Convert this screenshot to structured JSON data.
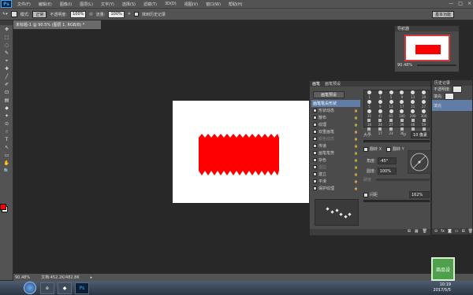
{
  "app": {
    "logo": "Ps"
  },
  "menu": [
    "文件(F)",
    "编辑(E)",
    "图像(I)",
    "图层(L)",
    "文字(Y)",
    "选择(S)",
    "滤镜(T)",
    "3D(D)",
    "视图(V)",
    "窗口(W)",
    "帮助(H)"
  ],
  "window_controls": {
    "minimize": "—",
    "maximize": "□",
    "close": "×"
  },
  "options_bar": {
    "mode_label": "模式:",
    "mode_value": "正常",
    "opacity_label": "不透明度:",
    "opacity_value": "100%",
    "flow_label": "流量:",
    "flow_value": "100%",
    "history_label": "抹到历史记录",
    "workspace_value": "基本功能"
  },
  "tools": [
    "✥",
    "⬚",
    "◌",
    "✎",
    "⌖",
    "✚",
    "╱",
    "✐",
    "⊡",
    "▤",
    "◆",
    "✦",
    "⊙",
    "☝",
    "T",
    "↖",
    "▭",
    "✋",
    "🔍"
  ],
  "document": {
    "tab_title": "未标题-1 @ 90.5% (图层 1, RGB/8) *",
    "zoom": "90.48%",
    "doc_size": "文档:452.2K/482.8K"
  },
  "navigator": {
    "title": "导航器",
    "zoom": "90.48%"
  },
  "history_panel": {
    "title": "历史记录",
    "opacity_label": "不透明度:",
    "fill_label": "填充:",
    "layer_name": "填充"
  },
  "brush_panel": {
    "tabs": [
      "画笔",
      "画笔预设"
    ],
    "preset_button": "画笔预设",
    "options": [
      {
        "label": "画笔笔尖形状",
        "active": true,
        "lock": false,
        "dim": false
      },
      {
        "label": "形状动态",
        "active": false,
        "lock": true,
        "dim": false
      },
      {
        "label": "散布",
        "active": false,
        "lock": true,
        "dim": false
      },
      {
        "label": "纹理",
        "active": false,
        "lock": true,
        "dim": false
      },
      {
        "label": "双重画笔",
        "active": false,
        "lock": true,
        "dim": false
      },
      {
        "label": "颜色动态",
        "active": false,
        "lock": true,
        "dim": true
      },
      {
        "label": "传递",
        "active": false,
        "lock": true,
        "dim": false
      },
      {
        "label": "画笔笔势",
        "active": false,
        "lock": true,
        "dim": false
      },
      {
        "label": "杂色",
        "active": false,
        "lock": true,
        "dim": false
      },
      {
        "label": "湿边",
        "active": false,
        "lock": true,
        "dim": true
      },
      {
        "label": "建立",
        "active": false,
        "lock": true,
        "dim": false
      },
      {
        "label": "平滑",
        "active": false,
        "lock": true,
        "dim": false
      },
      {
        "label": "保护纹理",
        "active": false,
        "lock": true,
        "dim": false
      }
    ],
    "tip_sizes": [
      "1",
      "3",
      "5",
      "9",
      "13",
      "19",
      "5",
      "9",
      "13",
      "17",
      "21",
      "27",
      "35",
      "45",
      "65",
      "100",
      "200",
      "300",
      "14",
      "24",
      "27",
      "39",
      "46",
      "59",
      "11",
      "17",
      "23",
      "36",
      "44",
      "60"
    ],
    "size_label": "大小",
    "size_value": "10 像素",
    "flip_x": "翻转 X",
    "flip_y": "翻转 Y",
    "angle_label": "角度:",
    "angle_value": "-45°",
    "roundness_label": "圆度:",
    "roundness_value": "100%",
    "hardness_label": "硬度",
    "spacing_label": "间距",
    "spacing_value": "162%",
    "footer_icons": [
      "⊞",
      "▦",
      "🗑"
    ]
  },
  "taskbar": {
    "time": "10:19",
    "date": "2017/5/5",
    "apps": [
      "e",
      "◆",
      "Ps"
    ]
  },
  "watermark": {
    "text": "商品设"
  },
  "colors": {
    "accent_red": "#ff0000",
    "active_blue": "#5f7da7"
  }
}
